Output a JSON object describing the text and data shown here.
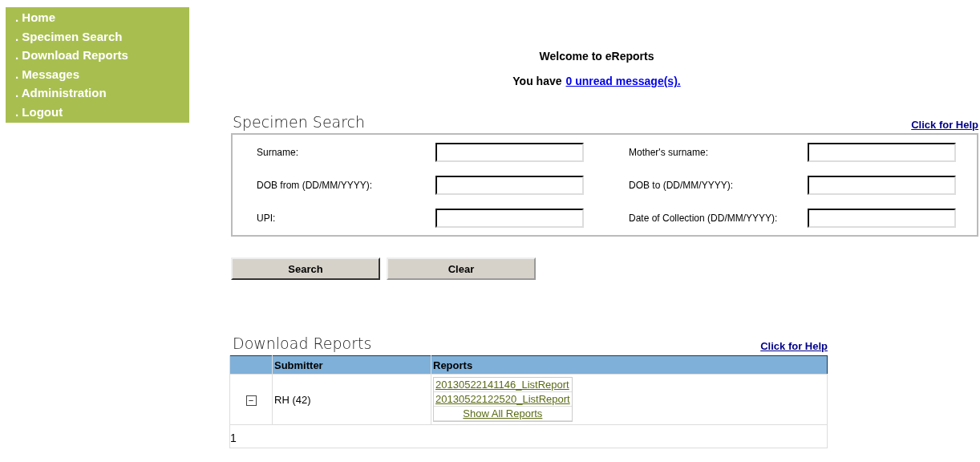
{
  "nav": [
    ". Home",
    ". Specimen Search",
    ". Download Reports",
    ". Messages",
    ". Administration",
    ". Logout"
  ],
  "welcome": {
    "title": "Welcome to eReports",
    "prefix": "You have",
    "link": "0 unread message(s)."
  },
  "search": {
    "title": "Specimen Search",
    "help": "Click for Help",
    "fields": [
      {
        "label": "Surname:"
      },
      {
        "label": "Mother's surname:"
      },
      {
        "label": "DOB from (DD/MM/YYYY):"
      },
      {
        "label": "DOB to (DD/MM/YYYY):"
      },
      {
        "label": "UPI:"
      },
      {
        "label": "Date of Collection (DD/MM/YYYY):"
      }
    ],
    "buttons": [
      "Search",
      "Clear"
    ]
  },
  "reports": {
    "title": "Download Reports",
    "help": "Click for Help",
    "columns": [
      "Submitter",
      "Reports"
    ],
    "rows": [
      {
        "expander": "−",
        "submitter": "RH (42)",
        "reports": [
          "20130522141146_ListReport",
          "20130522122520_ListReport"
        ],
        "show_all": "Show All Reports"
      }
    ],
    "pager": "1"
  }
}
